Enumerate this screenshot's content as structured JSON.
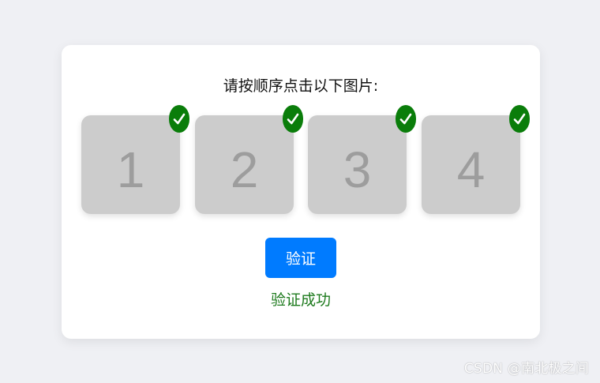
{
  "captcha": {
    "prompt": "请按顺序点击以下图片:",
    "tiles": [
      {
        "label": "1",
        "checked": true
      },
      {
        "label": "2",
        "checked": true
      },
      {
        "label": "3",
        "checked": true
      },
      {
        "label": "4",
        "checked": true
      }
    ],
    "check_icon": "checkmark-icon",
    "verify_label": "验证",
    "result_text": "验证成功",
    "colors": {
      "page_bg": "#eff0f4",
      "tile_bg": "#cccccc",
      "tile_number": "#9d9d9d",
      "check_bg": "#0a7d0a",
      "button_bg": "#007bff",
      "success_text": "#1d7a1d"
    }
  },
  "watermark": {
    "text": "CSDN @南北极之间"
  }
}
